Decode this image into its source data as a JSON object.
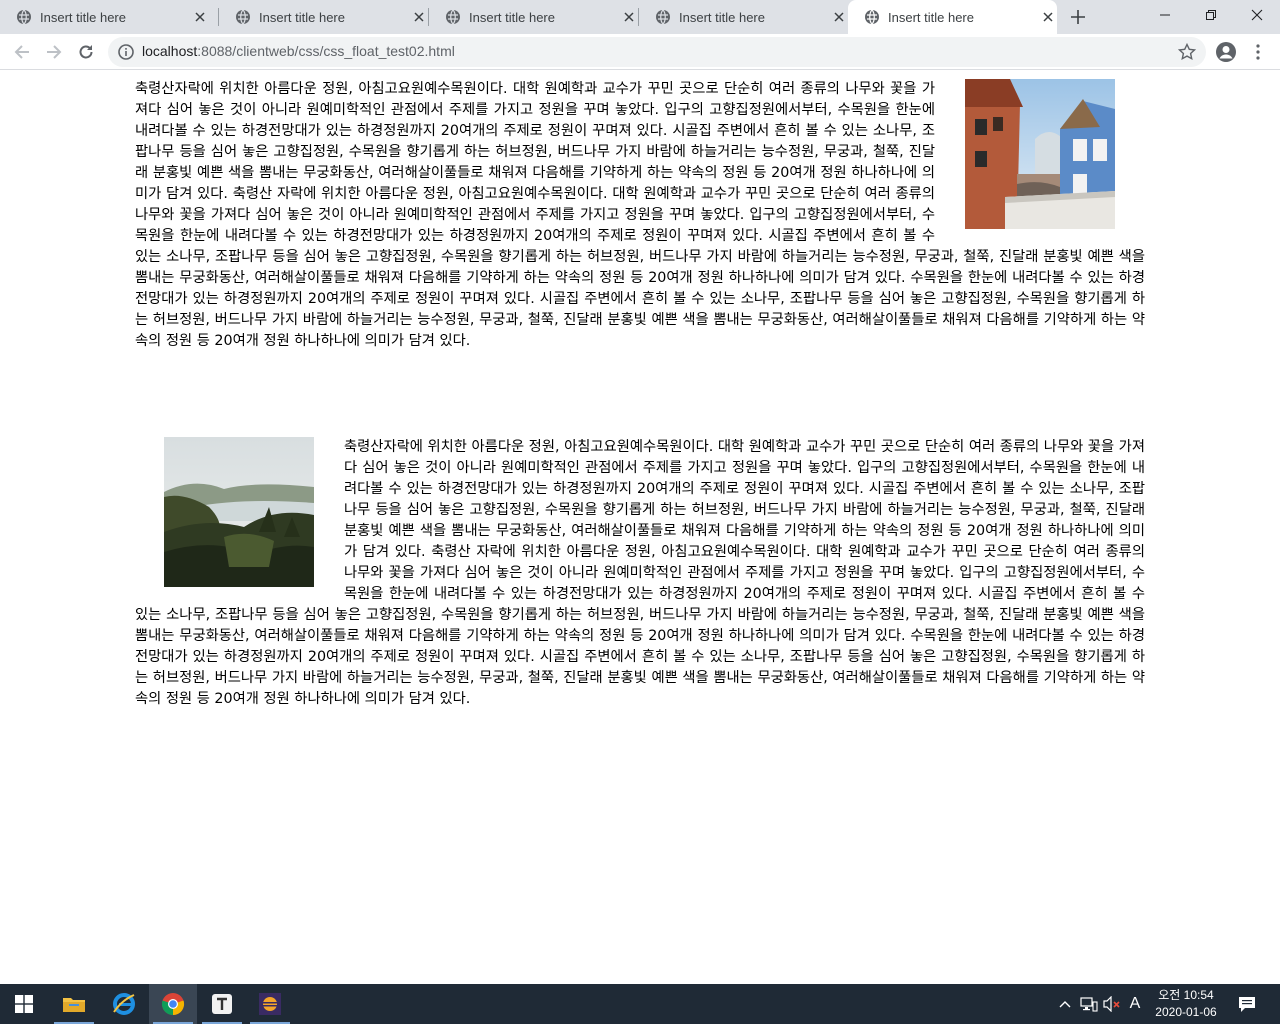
{
  "browser": {
    "tabs": [
      {
        "title": "Insert title here",
        "active": false
      },
      {
        "title": "Insert title here",
        "active": false
      },
      {
        "title": "Insert title here",
        "active": false
      },
      {
        "title": "Insert title here",
        "active": false
      },
      {
        "title": "Insert title here",
        "active": true
      }
    ],
    "url_host": "localhost",
    "url_rest": ":8088/clientweb/css/css_float_test02.html"
  },
  "content": {
    "section1_text": "축령산자락에 위치한 아름다운 정원, 아침고요원예수목원이다. 대학 원예학과 교수가 꾸민 곳으로 단순히 여러 종류의 나무와 꽃을 가져다 심어 놓은 것이 아니라 원예미학적인 관점에서 주제를 가지고 정원을 꾸며 놓았다. 입구의 고향집정원에서부터, 수목원을 한눈에 내려다볼 수 있는 하경전망대가 있는 하경정원까지 20여개의 주제로 정원이 꾸며져 있다. 시골집 주변에서 흔히 볼 수 있는 소나무, 조팝나무 등을 심어 놓은 고향집정원, 수목원을 향기롭게 하는 허브정원, 버드나무 가지 바람에 하늘거리는 능수정원, 무궁과, 철쭉, 진달래 분홍빛 예쁜 색을 뽐내는 무궁화동산, 여러해살이풀들로 채워져 다음해를 기약하게 하는 약속의 정원 등 20여개 정원 하나하나에 의미가 담겨 있다. 축령산 자락에 위치한 아름다운 정원, 아침고요원예수목원이다. 대학 원예학과 교수가 꾸민 곳으로 단순히 여러 종류의 나무와 꽃을 가져다 심어 놓은 것이 아니라 원예미학적인 관점에서 주제를 가지고 정원을 꾸며 놓았다. 입구의 고향집정원에서부터, 수목원을 한눈에 내려다볼 수 있는 하경전망대가 있는 하경정원까지 20여개의 주제로 정원이 꾸며져 있다. 시골집 주변에서 흔히 볼 수 있는 소나무, 조팝나무 등을 심어 놓은 고향집정원, 수목원을 향기롭게 하는 허브정원, 버드나무 가지 바람에 하늘거리는 능수정원, 무궁과, 철쭉, 진달래 분홍빛 예쁜 색을 뽐내는 무궁화동산, 여러해살이풀들로 채워져 다음해를 기약하게 하는 약속의 정원 등 20여개 정원 하나하나에 의미가 담겨 있다. 수목원을 한눈에 내려다볼 수 있는 하경전망대가 있는 하경정원까지 20여개의 주제로 정원이 꾸며져 있다. 시골집 주변에서 흔히 볼 수 있는 소나무, 조팝나무 등을 심어 놓은 고향집정원, 수목원을 향기롭게 하는 허브정원, 버드나무 가지 바람에 하늘거리는 능수정원, 무궁과, 철쭉, 진달래 분홍빛 예쁜 색을 뽐내는 무궁화동산, 여러해살이풀들로 채워져 다음해를 기약하게 하는 약속의 정원 등 20여개 정원 하나하나에 의미가 담겨 있다.",
    "section2_text": "축령산자락에 위치한 아름다운 정원, 아침고요원예수목원이다. 대학 원예학과 교수가 꾸민 곳으로 단순히 여러 종류의 나무와 꽃을 가져다 심어 놓은 것이 아니라 원예미학적인 관점에서 주제를 가지고 정원을 꾸며 놓았다. 입구의 고향집정원에서부터, 수목원을 한눈에 내려다볼 수 있는 하경전망대가 있는 하경정원까지 20여개의 주제로 정원이 꾸며져 있다. 시골집 주변에서 흔히 볼 수 있는 소나무, 조팝나무 등을 심어 놓은 고향집정원, 수목원을 향기롭게 하는 허브정원, 버드나무 가지 바람에 하늘거리는 능수정원, 무궁과, 철쭉, 진달래 분홍빛 예쁜 색을 뽐내는 무궁화동산, 여러해살이풀들로 채워져 다음해를 기약하게 하는 약속의 정원 등 20여개 정원 하나하나에 의미가 담겨 있다. 축령산 자락에 위치한 아름다운 정원, 아침고요원예수목원이다. 대학 원예학과 교수가 꾸민 곳으로 단순히 여러 종류의 나무와 꽃을 가져다 심어 놓은 것이 아니라 원예미학적인 관점에서 주제를 가지고 정원을 꾸며 놓았다. 입구의 고향집정원에서부터, 수목원을 한눈에 내려다볼 수 있는 하경전망대가 있는 하경정원까지 20여개의 주제로 정원이 꾸며져 있다. 시골집 주변에서 흔히 볼 수 있는 소나무, 조팝나무 등을 심어 놓은 고향집정원, 수목원을 향기롭게 하는 허브정원, 버드나무 가지 바람에 하늘거리는 능수정원, 무궁과, 철쭉, 진달래 분홍빛 예쁜 색을 뽐내는 무궁화동산, 여러해살이풀들로 채워져 다음해를 기약하게 하는 약속의 정원 등 20여개 정원 하나하나에 의미가 담겨 있다. 수목원을 한눈에 내려다볼 수 있는 하경전망대가 있는 하경정원까지 20여개의 주제로 정원이 꾸며져 있다. 시골집 주변에서 흔히 볼 수 있는 소나무, 조팝나무 등을 심어 놓은 고향집정원, 수목원을 향기롭게 하는 허브정원, 버드나무 가지 바람에 하늘거리는 능수정원, 무궁과, 철쭉, 진달래 분홍빛 예쁜 색을 뽐내는 무궁화동산, 여러해살이풀들로 채워져 다음해를 기약하게 하는 약속의 정원 등 20여개 정원 하나하나에 의미가 담겨 있다."
  },
  "taskbar": {
    "clock_time": "오전 10:54",
    "clock_date": "2020-01-06",
    "ime_label": "A"
  },
  "icons": {
    "tab_favicon": "globe-icon",
    "tab_close": "close-icon",
    "new_tab": "plus-icon",
    "window_buttons": [
      "minimize-icon",
      "restore-icon",
      "close-icon"
    ],
    "nav": [
      "back-arrow-icon",
      "forward-arrow-icon",
      "reload-icon"
    ],
    "omnibox": [
      "info-icon",
      "star-icon"
    ],
    "toolbar_right": [
      "account-icon",
      "menu-dots-icon"
    ],
    "taskbar_apps": [
      "windows-start-icon",
      "file-explorer-icon",
      "internet-explorer-icon",
      "chrome-icon",
      "typora-icon",
      "eclipse-icon"
    ],
    "tray": [
      "chevron-up-icon",
      "network-icon",
      "volume-muted-icon",
      "notification-icon"
    ]
  },
  "colors": {
    "tabstrip_bg": "#dee1e6",
    "taskbar_bg": "#1f2a36",
    "accent": "#1a73e8"
  }
}
